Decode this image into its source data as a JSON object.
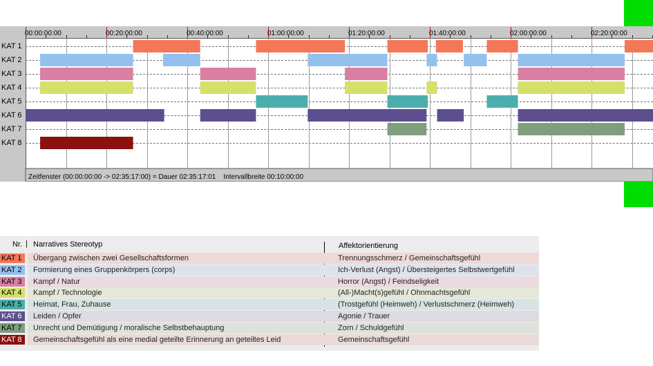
{
  "chart_data": {
    "type": "timeline",
    "time_ticks": [
      "00:00:00:00",
      "00:20:00:00",
      "00:40:00:00",
      "01:00:00:00",
      "01:20:00:00",
      "01:40:00:00",
      "02:00:00:00",
      "02:20:00:00"
    ],
    "x_unit": "minutes",
    "xlim": [
      0,
      155.28
    ],
    "rows": [
      "KAT 1",
      "KAT 2",
      "KAT 3",
      "KAT 4",
      "KAT 5",
      "KAT 6",
      "KAT 7",
      "KAT 8"
    ],
    "colors": [
      "#f47858",
      "#94c0ee",
      "#d97fa3",
      "#d4e06a",
      "#4aaeac",
      "#5d4f8f",
      "#7f9e7e",
      "#8c1010"
    ],
    "segments": [
      {
        "row": 0,
        "start": 26.6,
        "end": 43.2
      },
      {
        "row": 0,
        "start": 57.0,
        "end": 79.0
      },
      {
        "row": 0,
        "start": 89.5,
        "end": 99.5
      },
      {
        "row": 0,
        "start": 101.5,
        "end": 108.2
      },
      {
        "row": 0,
        "start": 114.1,
        "end": 121.8
      },
      {
        "row": 0,
        "start": 148.2,
        "end": 155.28
      },
      {
        "row": 1,
        "start": 3.6,
        "end": 26.6
      },
      {
        "row": 1,
        "start": 34.0,
        "end": 43.2
      },
      {
        "row": 1,
        "start": 69.8,
        "end": 89.5
      },
      {
        "row": 1,
        "start": 99.2,
        "end": 101.8
      },
      {
        "row": 1,
        "start": 108.4,
        "end": 114.1
      },
      {
        "row": 1,
        "start": 121.8,
        "end": 148.2
      },
      {
        "row": 2,
        "start": 3.6,
        "end": 26.6
      },
      {
        "row": 2,
        "start": 43.2,
        "end": 57.0
      },
      {
        "row": 2,
        "start": 79.0,
        "end": 89.5
      },
      {
        "row": 2,
        "start": 121.8,
        "end": 148.2
      },
      {
        "row": 3,
        "start": 3.6,
        "end": 26.6
      },
      {
        "row": 3,
        "start": 43.2,
        "end": 57.0
      },
      {
        "row": 3,
        "start": 79.0,
        "end": 89.5
      },
      {
        "row": 3,
        "start": 99.2,
        "end": 101.8
      },
      {
        "row": 3,
        "start": 121.8,
        "end": 148.2
      },
      {
        "row": 4,
        "start": 57.0,
        "end": 69.8
      },
      {
        "row": 4,
        "start": 89.5,
        "end": 99.5
      },
      {
        "row": 4,
        "start": 114.1,
        "end": 121.8
      },
      {
        "row": 5,
        "start": 0,
        "end": 34.3
      },
      {
        "row": 5,
        "start": 43.2,
        "end": 57.0
      },
      {
        "row": 5,
        "start": 69.8,
        "end": 99.2
      },
      {
        "row": 5,
        "start": 101.8,
        "end": 108.4
      },
      {
        "row": 5,
        "start": 121.8,
        "end": 155.28
      },
      {
        "row": 6,
        "start": 89.5,
        "end": 99.2
      },
      {
        "row": 6,
        "start": 121.8,
        "end": 148.2
      },
      {
        "row": 7,
        "start": 3.6,
        "end": 26.6
      }
    ],
    "status_text": "Zeitfenster (00:00:00:00 -> 02:35:17:00) = Dauer 02:35:17:01    Intervallbreite 00:10:00:00"
  },
  "legend": {
    "header_nr": "Nr.",
    "header_stereotype": "Narratives Stereotyp",
    "header_affect": "Affektorientierung",
    "rows": [
      {
        "code": "KAT 1",
        "stereotype": "Übergang zwischen zwei Gesellschaftsformen",
        "affect": "Trennungsschmerz / Gemeinschaftsgefühl",
        "color": "#f47858",
        "bg": "#eed9d6",
        "text_color": "#000000"
      },
      {
        "code": "KAT 2",
        "stereotype": "Formierung eines Gruppenkörpers (corps)",
        "affect": "Ich-Verlust (Angst) / Übersteigertes Selbstwertgefühl",
        "color": "#94c0ee",
        "bg": "#dde3ea",
        "text_color": "#000000"
      },
      {
        "code": "KAT 3",
        "stereotype": "Kampf / Natur",
        "affect": "Horror (Angst) / Feindseligkeit",
        "color": "#d97fa3",
        "bg": "#eadbe0",
        "text_color": "#000000"
      },
      {
        "code": "KAT 4",
        "stereotype": "Kampf / Technologie",
        "affect": "(All-)Macht(s)gefühl / Ohnmachtsgefühl",
        "color": "#d4e06a",
        "bg": "#e5e7d8",
        "text_color": "#000000"
      },
      {
        "code": "KAT 5",
        "stereotype": "Heimat, Frau, Zuhause",
        "affect": "(Trostgefühl (Heimweh) / Verlustschmerz (Heimweh)",
        "color": "#4aaeac",
        "bg": "#d6e4e3",
        "text_color": "#000000"
      },
      {
        "code": "KAT 6",
        "stereotype": "Leiden / Opfer",
        "affect": "Agonie / Trauer",
        "color": "#5d4f8f",
        "bg": "#dcdbe3",
        "text_color": "#ffffff"
      },
      {
        "code": "KAT 7",
        "stereotype": "Unrecht und Demütigung / moralische Selbstbehauptung",
        "affect": "Zorn / Schuldgefühl",
        "color": "#7f9e7e",
        "bg": "#dde3dc",
        "text_color": "#000000"
      },
      {
        "code": "KAT 8",
        "stereotype": "Gemeinschaftsgefühl als eine medial geteilte Erinnerung an geteiltes Leid",
        "affect": "Gemeinschaftsgefühl",
        "color": "#8c1010",
        "bg": "#eadada",
        "text_color": "#ffffff"
      }
    ]
  }
}
